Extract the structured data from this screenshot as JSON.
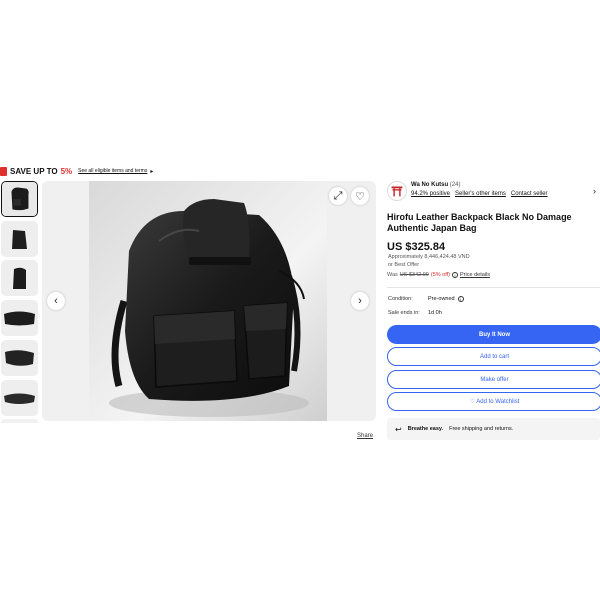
{
  "promo": {
    "save_text": "SAVE UP TO",
    "save_pct": "5%",
    "link": "See all eligible items and terms",
    "arrow": "▸"
  },
  "gallery": {
    "thumbnails": 6,
    "selected_index": 0,
    "share_label": "Share"
  },
  "seller": {
    "name": "Wa No Kutsu",
    "count": "(24)",
    "positive": "94.2% positive",
    "other_items": "Seller's other items",
    "contact": "Contact seller"
  },
  "item": {
    "title": "Hirofu Leather Backpack Black No Damage Authentic Japan Bag",
    "price": "US $325.84",
    "approx": "Approximately 8,446,424.48 VND",
    "best_offer": "or Best Offer",
    "was_label": "Was",
    "was_price": "US $342.99",
    "off": "(5% off)",
    "price_details": "Price details"
  },
  "details": {
    "condition_label": "Condition:",
    "condition_value": "Pre-owned",
    "sale_label": "Sale ends in:",
    "sale_value": "1d 0h"
  },
  "actions": {
    "buy_now": "Buy It Now",
    "add_to_cart": "Add to cart",
    "make_offer": "Make offer",
    "watchlist": "♡ Add to Watchlist"
  },
  "breathe": {
    "bold": "Breathe easy.",
    "text": "Free shipping and returns."
  },
  "colors": {
    "accent": "#3665f3",
    "sale_red": "#e0302d"
  }
}
